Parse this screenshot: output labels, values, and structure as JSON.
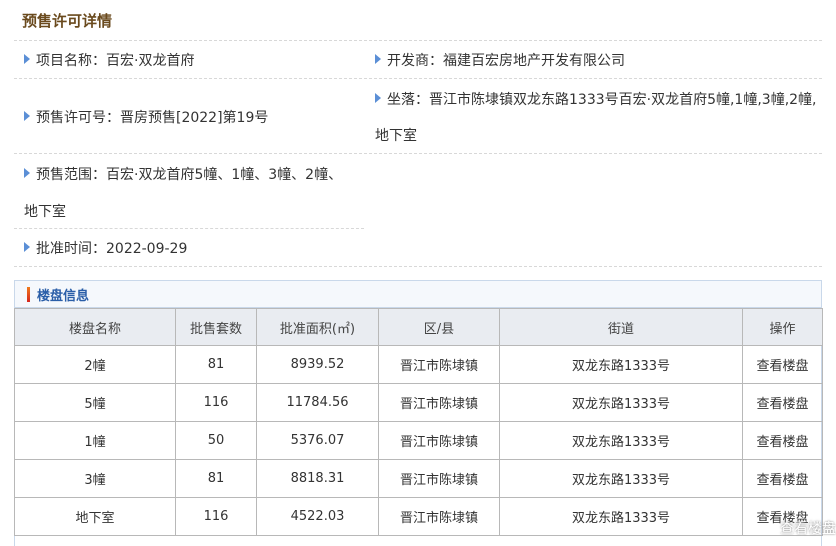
{
  "page_title": "预售许可详情",
  "info": {
    "project_name": "项目名称：百宏·双龙首府",
    "developer": "开发商：福建百宏房地产开发有限公司",
    "permit_no": "预售许可号：晋房预售[2022]第19号",
    "location_line1": "坐落：晋江市陈埭镇双龙东路1333号百宏·双龙首府5幢,1幢,3幢,2幢,",
    "location_line2": "地下室",
    "scope_line1": "预售范围：百宏·双龙首府5幢、1幢、3幢、2幢、",
    "scope_line2": "地下室",
    "approval_date": "批准时间：2022-09-29"
  },
  "section": {
    "title": "楼盘信息"
  },
  "table": {
    "headers": [
      "楼盘名称",
      "批售套数",
      "批准面积(㎡)",
      "区/县",
      "街道",
      "操作"
    ],
    "rows": [
      [
        "2幢",
        "81",
        "8939.52",
        "晋江市陈埭镇",
        "双龙东路1333号",
        "查看楼盘"
      ],
      [
        "5幢",
        "116",
        "11784.56",
        "晋江市陈埭镇",
        "双龙东路1333号",
        "查看楼盘"
      ],
      [
        "1幢",
        "50",
        "5376.07",
        "晋江市陈埭镇",
        "双龙东路1333号",
        "查看楼盘"
      ],
      [
        "3幢",
        "81",
        "8818.31",
        "晋江市陈埭镇",
        "双龙东路1333号",
        "查看楼盘"
      ],
      [
        "地下室",
        "116",
        "4522.03",
        "晋江市陈埭镇",
        "双龙东路1333号",
        "查看楼盘"
      ]
    ]
  },
  "watermark": "查看楼盘",
  "colors": {
    "title": "#6a4a1e",
    "arrow": "#5b8fd6",
    "section_title": "#2a5ea8",
    "header_bg": "#e9ecf1"
  }
}
